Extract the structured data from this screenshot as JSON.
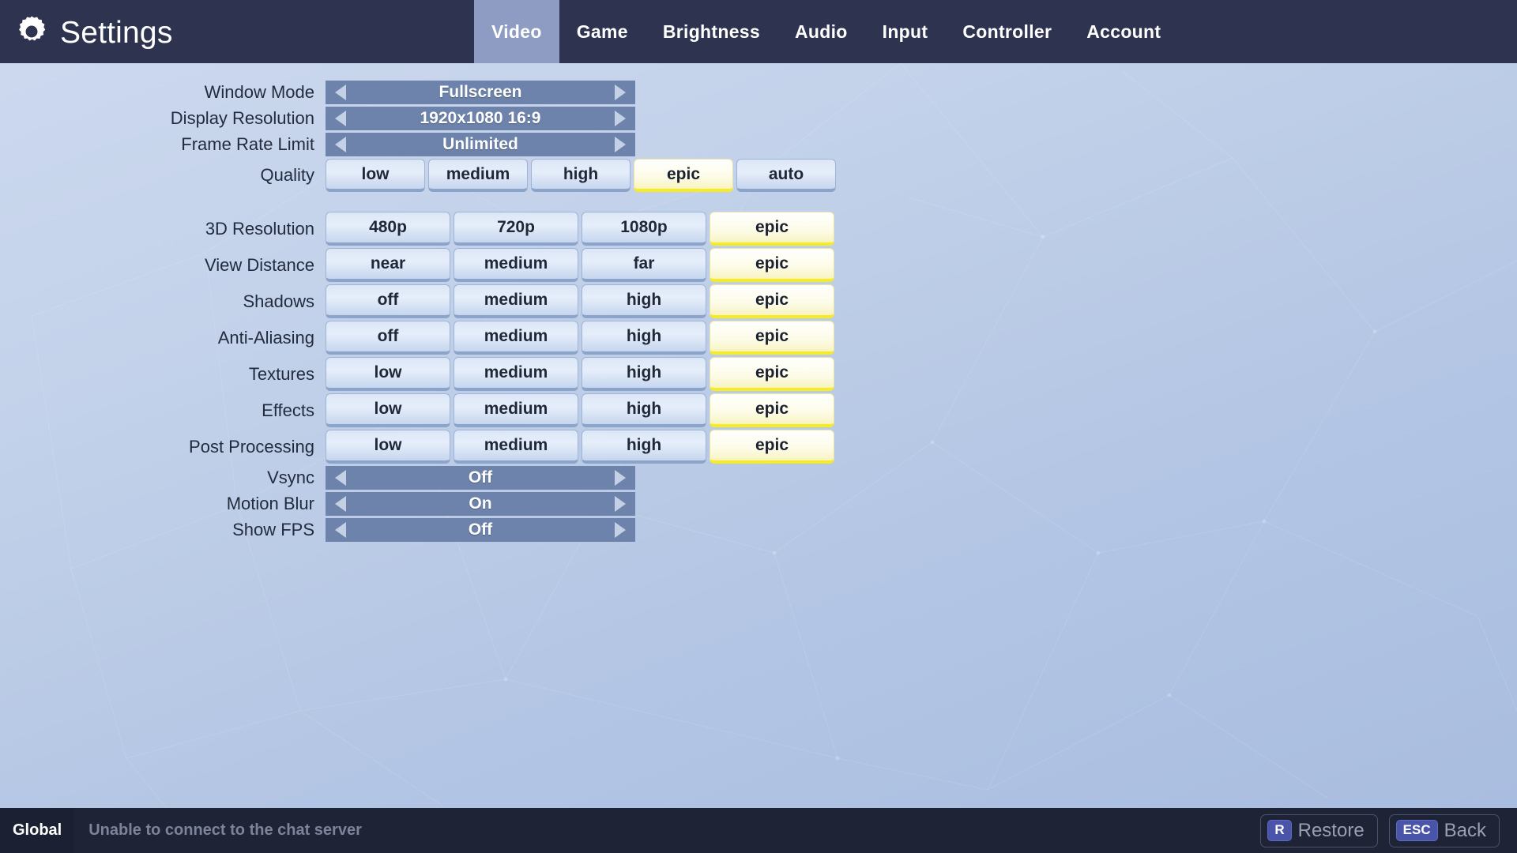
{
  "header": {
    "title": "Settings",
    "gear_icon": "gear-icon",
    "tabs": [
      {
        "label": "Video",
        "active": true
      },
      {
        "label": "Game",
        "active": false
      },
      {
        "label": "Brightness",
        "active": false
      },
      {
        "label": "Audio",
        "active": false
      },
      {
        "label": "Input",
        "active": false
      },
      {
        "label": "Controller",
        "active": false
      },
      {
        "label": "Account",
        "active": false
      }
    ]
  },
  "settings": {
    "spinners_top": [
      {
        "label": "Window Mode",
        "value": "Fullscreen"
      },
      {
        "label": "Display Resolution",
        "value": "1920x1080 16:9"
      },
      {
        "label": "Frame Rate Limit",
        "value": "Unlimited"
      }
    ],
    "quality": {
      "label": "Quality",
      "options": [
        "low",
        "medium",
        "high",
        "epic",
        "auto"
      ],
      "selected": "epic"
    },
    "groups": [
      {
        "label": "3D Resolution",
        "options": [
          "480p",
          "720p",
          "1080p",
          "epic"
        ],
        "selected": "epic"
      },
      {
        "label": "View Distance",
        "options": [
          "near",
          "medium",
          "far",
          "epic"
        ],
        "selected": "epic"
      },
      {
        "label": "Shadows",
        "options": [
          "off",
          "medium",
          "high",
          "epic"
        ],
        "selected": "epic"
      },
      {
        "label": "Anti-Aliasing",
        "options": [
          "off",
          "medium",
          "high",
          "epic"
        ],
        "selected": "epic"
      },
      {
        "label": "Textures",
        "options": [
          "low",
          "medium",
          "high",
          "epic"
        ],
        "selected": "epic"
      },
      {
        "label": "Effects",
        "options": [
          "low",
          "medium",
          "high",
          "epic"
        ],
        "selected": "epic"
      },
      {
        "label": "Post Processing",
        "options": [
          "low",
          "medium",
          "high",
          "epic"
        ],
        "selected": "epic"
      }
    ],
    "spinners_bottom": [
      {
        "label": "Vsync",
        "value": "Off"
      },
      {
        "label": "Motion Blur",
        "value": "On"
      },
      {
        "label": "Show FPS",
        "value": "Off"
      }
    ]
  },
  "footer": {
    "chat_channel": "Global",
    "chat_status": "Unable to connect to the chat server",
    "actions": [
      {
        "key": "R",
        "label": "Restore"
      },
      {
        "key": "ESC",
        "label": "Back"
      }
    ]
  },
  "colors": {
    "header_bg": "#2e3350",
    "tab_active_bg": "#8e9cc4",
    "spinner_bg": "#6d83ab",
    "selected_accent": "#f6ec1f",
    "footer_bg": "#1e2336",
    "keycap_bg": "#4a54a8"
  }
}
